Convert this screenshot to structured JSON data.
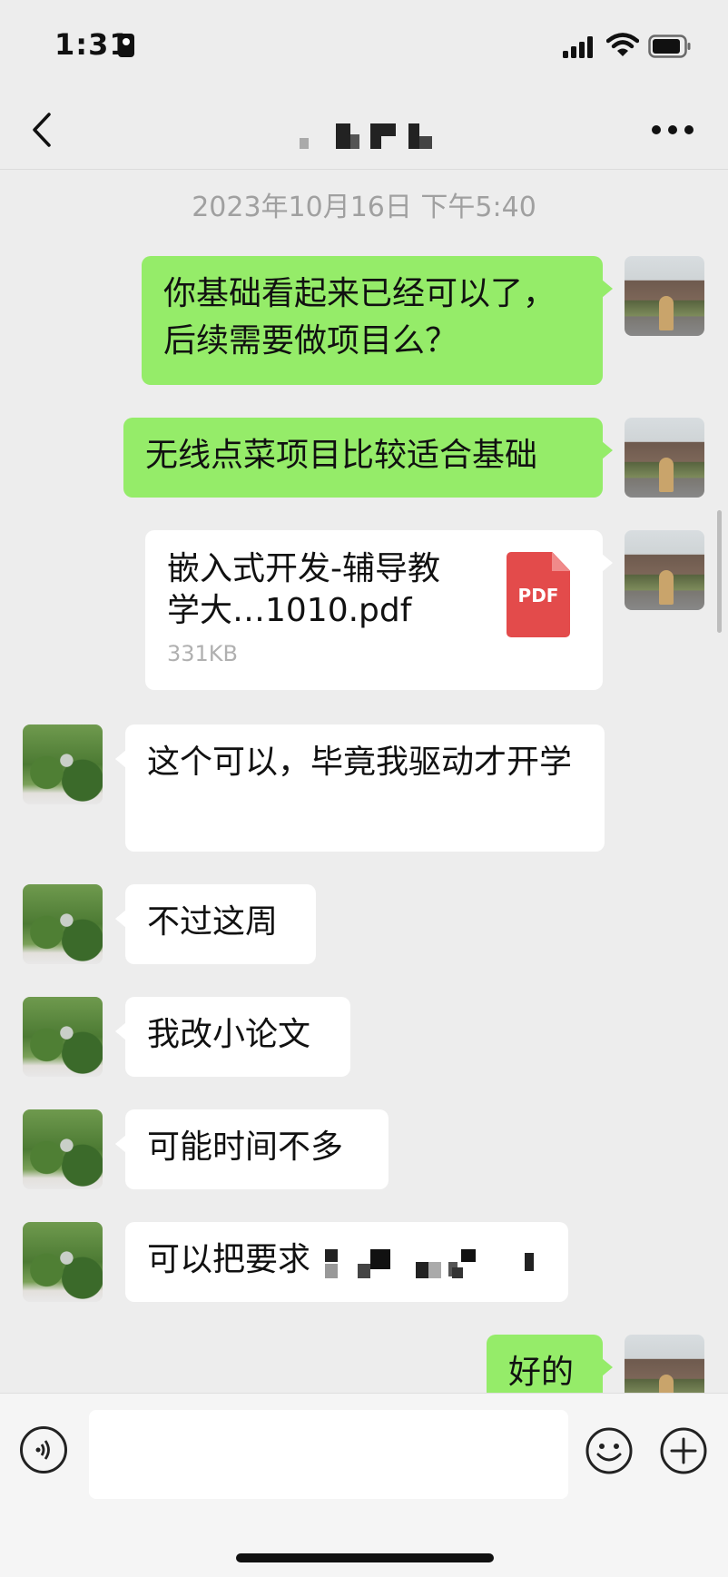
{
  "status_bar": {
    "time": "1:31"
  },
  "header": {
    "title": ""
  },
  "timestamp": "2023年10月16日 下午5:40",
  "messages": [
    {
      "sender": "me",
      "text": "你基础看起来已经可以了，后续需要做项目么？"
    },
    {
      "sender": "me",
      "text": "无线点菜项目比较适合基础"
    },
    {
      "sender": "me",
      "type": "file",
      "file_name": "嵌入式开发-辅导教学大…1010.pdf",
      "file_size": "331KB",
      "file_type": "PDF"
    },
    {
      "sender": "other",
      "text": "这个可以，毕竟我驱动才开学"
    },
    {
      "sender": "other",
      "text": "不过这周"
    },
    {
      "sender": "other",
      "text": "我改小论文"
    },
    {
      "sender": "other",
      "text": "可能时间不多"
    },
    {
      "sender": "other",
      "text": "可以把要求"
    },
    {
      "sender": "me",
      "text": "好的"
    }
  ],
  "colors": {
    "my_bubble": "#95ec69",
    "other_bubble": "#ffffff",
    "background": "#ededed",
    "pdf_red": "#e34b4b"
  },
  "icons": {
    "back": "chevron-left-icon",
    "more": "more-dots-icon",
    "voice": "voice-icon",
    "emoji": "emoji-icon",
    "plus": "plus-icon"
  }
}
